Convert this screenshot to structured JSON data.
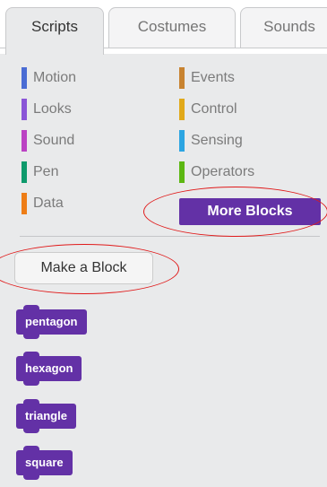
{
  "tabs": [
    {
      "label": "Scripts",
      "active": true
    },
    {
      "label": "Costumes",
      "active": false
    },
    {
      "label": "Sounds",
      "active": false
    }
  ],
  "categories": [
    {
      "label": "Motion",
      "color": "#4a6cd4"
    },
    {
      "label": "Looks",
      "color": "#8a55d7"
    },
    {
      "label": "Sound",
      "color": "#bb42c3"
    },
    {
      "label": "Pen",
      "color": "#0e9a6c"
    },
    {
      "label": "Data",
      "color": "#ee7d16"
    },
    {
      "label": "Events",
      "color": "#c88330"
    },
    {
      "label": "Control",
      "color": "#e1a91a"
    },
    {
      "label": "Sensing",
      "color": "#2ca5e2"
    },
    {
      "label": "Operators",
      "color": "#5cb712"
    }
  ],
  "selected_category": {
    "label": "More Blocks",
    "color": "#6331a6"
  },
  "make_block_label": "Make a Block",
  "custom_blocks": [
    "pentagon",
    "hexagon",
    "triangle",
    "square"
  ],
  "highlight_color": "#e01a1a"
}
